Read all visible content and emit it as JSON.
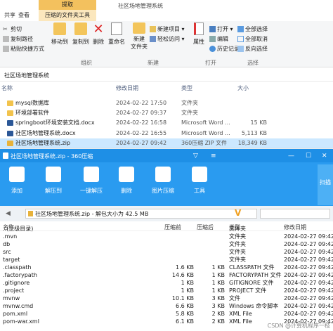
{
  "ribbon_tabs": {
    "home": "主页",
    "share": "共享",
    "view": "查看",
    "extract": "提取",
    "compressed_tools": "压缩的文件夹工具"
  },
  "window_title": "社区场地管理系统",
  "ribbon": {
    "cut": "剪切",
    "copy_path": "复制路径",
    "paste_shortcut": "粘贴快捷方式",
    "move_to": "移动到",
    "copy_to": "复制到",
    "delete": "删除",
    "rename": "重命名",
    "new_folder": "新建\n文件夹",
    "new_item": "新建项目 ▾",
    "easy_access": "轻松访问 ▾",
    "properties": "属性",
    "open": "打开 ▾",
    "edit": "编辑",
    "history": "历史记录",
    "select_all": "全部选择",
    "select_none": "全部取消",
    "invert_selection": "反向选择",
    "group_organize": "组织",
    "group_new": "新建",
    "group_open": "打开",
    "group_select": "选择"
  },
  "address": "社区场地管理系统",
  "columns": {
    "name": "名称",
    "date": "修改日期",
    "type": "类型",
    "size": "大小"
  },
  "files": [
    {
      "name": "mysql数据库",
      "date": "2024-02-22 17:50",
      "type": "文件夹",
      "size": "",
      "icon": "folder"
    },
    {
      "name": "环境部署软件",
      "date": "2024-02-27 09:37",
      "type": "文件夹",
      "size": "",
      "icon": "folder"
    },
    {
      "name": "springboot环境安装文档.docx",
      "date": "2024-02-22 16:58",
      "type": "Microsoft Word ...",
      "size": "15 KB",
      "icon": "doc"
    },
    {
      "name": "社区场地管理系统.docx",
      "date": "2024-02-22 16:55",
      "type": "Microsoft Word ...",
      "size": "5,113 KB",
      "icon": "doc"
    },
    {
      "name": "社区场地管理系统.zip",
      "date": "2024-02-27 09:42",
      "type": "360压缩 ZIP 文件",
      "size": "18,349 KB",
      "icon": "zip"
    }
  ],
  "zip": {
    "title": "社区场地管理系统.zip - 360压缩",
    "buttons": [
      "添加",
      "解压到",
      "一键解压",
      "删除",
      "图片压缩",
      "工具"
    ],
    "scan": "扫描",
    "path": "社区场地管理系统.zip - 解包大小为 42.5 MB",
    "columns": {
      "name": "名称",
      "packed": "压缩前",
      "unpacked": "压缩后",
      "type": "类型",
      "date": "修改日期"
    },
    "rows": [
      {
        "name": "..(上级目录)",
        "packed": "",
        "unpacked": "",
        "type": "文件夹",
        "date": ""
      },
      {
        "name": ".mvn",
        "packed": "",
        "unpacked": "",
        "type": "文件夹",
        "date": "2024-02-27 09:42"
      },
      {
        "name": "db",
        "packed": "",
        "unpacked": "",
        "type": "文件夹",
        "date": "2024-02-27 09:42"
      },
      {
        "name": "src",
        "packed": "",
        "unpacked": "",
        "type": "文件夹",
        "date": "2024-02-27 09:42"
      },
      {
        "name": "target",
        "packed": "",
        "unpacked": "",
        "type": "文件夹",
        "date": "2024-02-27 09:42"
      },
      {
        "name": ".classpath",
        "packed": "1.6 KB",
        "unpacked": "1 KB",
        "type": "CLASSPATH 文件",
        "date": "2024-02-27 09:42"
      },
      {
        "name": ".factorypath",
        "packed": "14.6 KB",
        "unpacked": "1 KB",
        "type": "FACTORYPATH 文件",
        "date": "2024-02-27 09:42"
      },
      {
        "name": ".gitignore",
        "packed": "1 KB",
        "unpacked": "1 KB",
        "type": "GITIGNORE 文件",
        "date": "2024-02-27 09:42"
      },
      {
        "name": ".project",
        "packed": "1 KB",
        "unpacked": "1 KB",
        "type": "PROJECT 文件",
        "date": "2024-02-27 09:42"
      },
      {
        "name": "mvnw",
        "packed": "10.1 KB",
        "unpacked": "3 KB",
        "type": "文件",
        "date": "2024-02-27 09:42"
      },
      {
        "name": "mvnw.cmd",
        "packed": "6.6 KB",
        "unpacked": "3 KB",
        "type": "Windows 命令脚本",
        "date": "2024-02-27 09:42"
      },
      {
        "name": "pom.xml",
        "packed": "5.8 KB",
        "unpacked": "2 KB",
        "type": "XML File",
        "date": "2024-02-27 09:42"
      },
      {
        "name": "pom-war.xml",
        "packed": "6.1 KB",
        "unpacked": "2 KB",
        "type": "XML File",
        "date": "2024-02-27 09:42"
      }
    ]
  },
  "watermark": "CSDN @计算机程序一枝"
}
